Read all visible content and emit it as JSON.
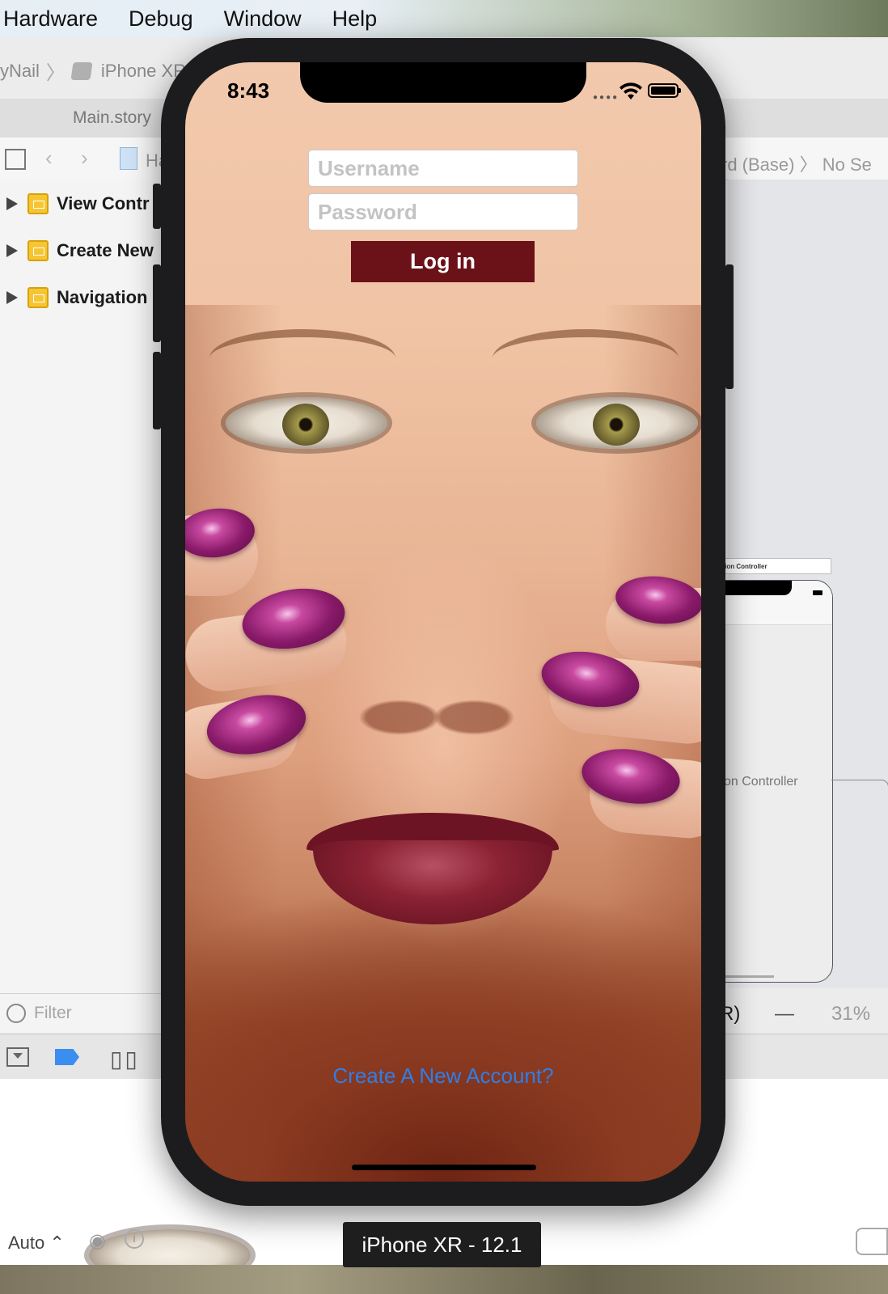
{
  "menubar": {
    "items": [
      "Hardware",
      "Debug",
      "Window",
      "Help"
    ]
  },
  "xcode": {
    "scheme_project": "yNail",
    "scheme_device": "iPhone XR",
    "tab_title": "Main.story",
    "jump_crumb_left": "Ha",
    "jump_crumb_right": "rd (Base)",
    "jump_crumb_tail": "No Se",
    "outline_items": [
      "View Contr",
      "Create New",
      "Navigation"
    ],
    "filter_placeholder": "Filter",
    "canvas_scene_title": "ation Controller",
    "canvas_scene_label": "on Controller",
    "zoom_left": "R)",
    "zoom_dash": "—",
    "zoom_percent": "31%",
    "bottom_auto": "Auto ⌃"
  },
  "simulator": {
    "status_time": "8:43",
    "username_placeholder": "Username",
    "password_placeholder": "Password",
    "login_label": "Log in",
    "create_account_link": "Create A New Account?",
    "device_label": "iPhone XR - 12.1"
  },
  "colors": {
    "login_button": "#6b1118",
    "link": "#2f7ee8",
    "device_frame": "#1c1c1e"
  }
}
